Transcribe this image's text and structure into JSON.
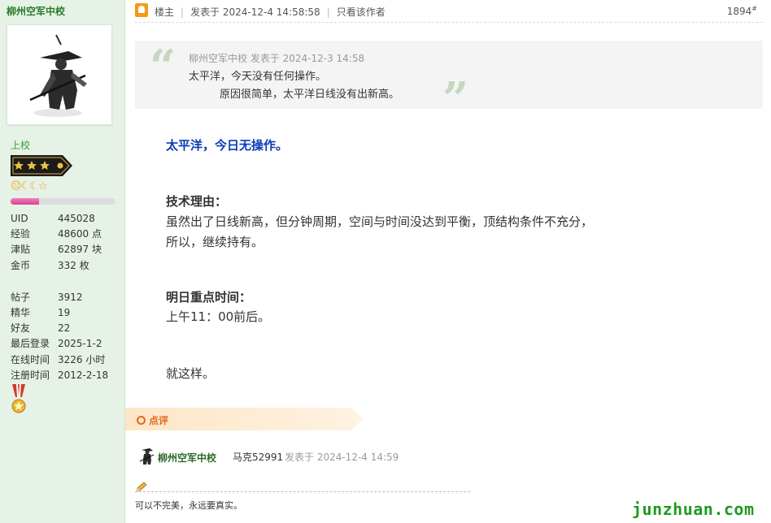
{
  "sidebar": {
    "username": "柳州空军中校",
    "rank": "上校",
    "level_icons": "😐☾☾☆",
    "progress_fraction": 0.27,
    "stats": [
      {
        "label": "UID",
        "value": "445028"
      },
      {
        "label": "经验",
        "value": "48600 点"
      },
      {
        "label": "津贴",
        "value": "62897 块"
      },
      {
        "label": "金币",
        "value": "332 枚"
      }
    ],
    "stats2": [
      {
        "label": "帖子",
        "value": "3912"
      },
      {
        "label": "精华",
        "value": "19"
      },
      {
        "label": "好友",
        "value": "22"
      },
      {
        "label": "最后登录",
        "value": "2025-1-2"
      },
      {
        "label": "在线时间",
        "value": "3226 小时"
      },
      {
        "label": "注册时间",
        "value": "2012-2-18"
      }
    ]
  },
  "post_header": {
    "role": "楼主",
    "posted": "发表于 2024-12-4 14:58:58",
    "only_author": "只看该作者",
    "floor": "1894",
    "floor_sup": "#"
  },
  "quote": {
    "meta": "柳州空军中校 发表于 2024-12-3 14:58",
    "line1": "太平洋，今天没有任何操作。",
    "line2": "原因很简单，太平洋日线没有出新高。"
  },
  "content": {
    "headline": "太平洋，今日无操作。",
    "reason_title": "技术理由：",
    "reason_l1": "虽然出了日线新高，但分钟周期，空间与时间没达到平衡，顶结构条件不充分，",
    "reason_l2": "所以，继续持有。",
    "time_title": "明日重点时间：",
    "time_value": "上午11：00前后。",
    "closing": "就这样。"
  },
  "comments": {
    "tab_label": "点评",
    "author": "柳州空军中校",
    "text": "马克52991",
    "meta": "发表于 2024-12-4 14:59"
  },
  "signature": "可以不完美，永远要真实。",
  "watermark": "junzhuan.com",
  "colors": {
    "sidebar_bg": "#e6f2e6",
    "headline_blue": "#0a3cb8",
    "comment_orange": "#e06a1a",
    "watermark_green": "#1f9a1f"
  }
}
